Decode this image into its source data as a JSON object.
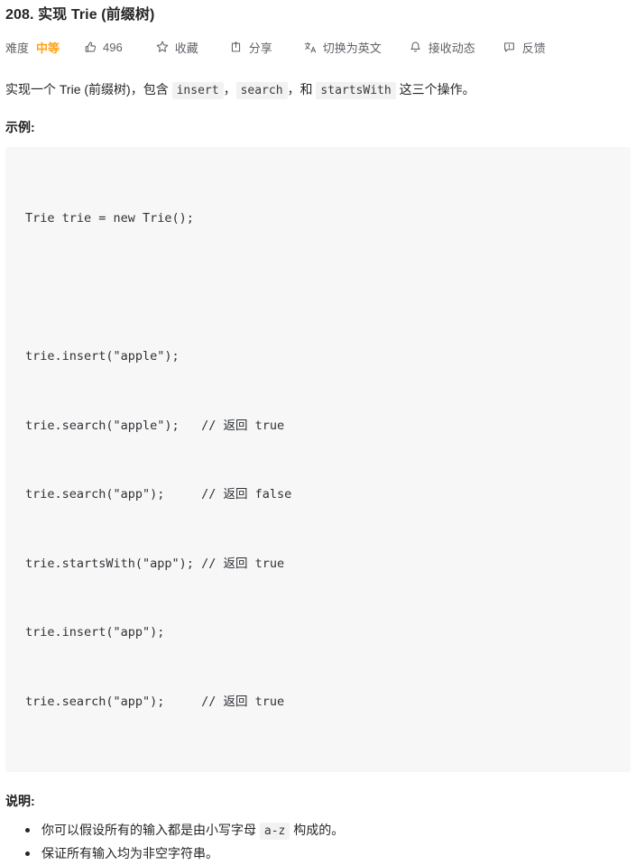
{
  "problem": {
    "title": "208. 实现 Trie (前缀树)"
  },
  "meta": {
    "difficulty_label": "难度",
    "difficulty_value": "中等",
    "difficulty_color": "#ffa116",
    "likes": {
      "icon": "thumbs-up-icon",
      "count": "496"
    },
    "favorite": {
      "icon": "star-icon",
      "label": "收藏"
    },
    "share": {
      "icon": "share-icon",
      "label": "分享"
    },
    "translate": {
      "icon": "translate-icon",
      "label": "切换为英文"
    },
    "subscribe": {
      "icon": "bell-icon",
      "label": "接收动态"
    },
    "feedback": {
      "icon": "feedback-icon",
      "label": "反馈"
    }
  },
  "description": {
    "part1": "实现一个 Trie (前缀树)，包含 ",
    "code1": "insert",
    "sep1": "，",
    "code2": "search",
    "sep2": "，和 ",
    "code3": "startsWith",
    "part2": " 这三个操作。"
  },
  "example": {
    "heading": "示例:",
    "code_lines": [
      "Trie trie = new Trie();",
      "",
      "trie.insert(\"apple\");",
      "trie.search(\"apple\");   // 返回 true",
      "trie.search(\"app\");     // 返回 false",
      "trie.startsWith(\"app\"); // 返回 true",
      "trie.insert(\"app\");",
      "trie.search(\"app\");     // 返回 true"
    ]
  },
  "notes": {
    "heading": "说明:",
    "items": [
      {
        "before": "你可以假设所有的输入都是由小写字母 ",
        "code": "a-z",
        "after": " 构成的。"
      },
      {
        "before": "保证所有输入均为非空字符串。",
        "code": "",
        "after": ""
      }
    ]
  },
  "colors": {
    "code_bg": "#f7f7f7",
    "inline_code_bg": "#f2f2f2",
    "text": "#262626",
    "muted": "#5f6368"
  }
}
